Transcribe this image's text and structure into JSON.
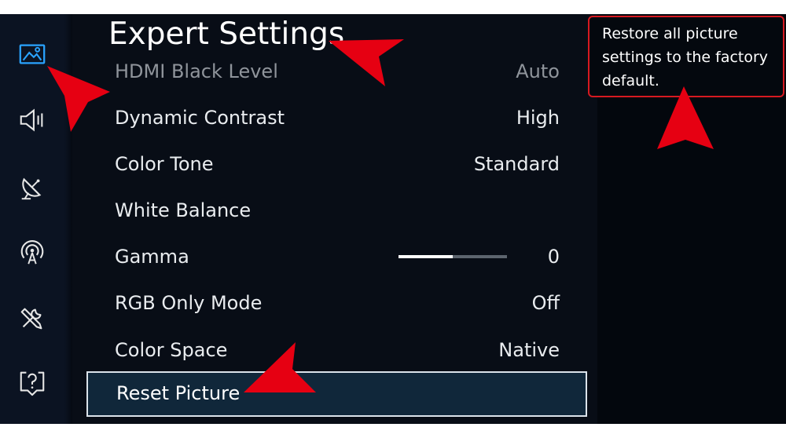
{
  "title": "Expert Settings",
  "sidebar": [
    {
      "name": "picture",
      "icon": "picture-icon",
      "active": true
    },
    {
      "name": "sound",
      "icon": "speaker-icon"
    },
    {
      "name": "broadcasting",
      "icon": "satellite-dish-icon"
    },
    {
      "name": "network",
      "icon": "network-signal-icon"
    },
    {
      "name": "support",
      "icon": "tools-icon"
    },
    {
      "name": "help",
      "icon": "help-question-icon"
    }
  ],
  "settings": [
    {
      "label": "HDMI Black Level",
      "value": "Auto"
    },
    {
      "label": "Dynamic Contrast",
      "value": "High"
    },
    {
      "label": "Color Tone",
      "value": "Standard"
    },
    {
      "label": "White Balance",
      "value": ""
    },
    {
      "label": "Gamma",
      "value": "0",
      "slider_level": 0.5
    },
    {
      "label": "RGB Only Mode",
      "value": "Off"
    },
    {
      "label": "Color Space",
      "value": "Native"
    },
    {
      "label": "Reset Picture",
      "value": "",
      "selected": true
    }
  ],
  "help_text": "Restore all picture settings to the factory default.",
  "colors": {
    "annotation_red": "#e60012",
    "help_border": "#d71920",
    "selected_background": "#10273a",
    "active_icon": "#2aa3ff"
  }
}
